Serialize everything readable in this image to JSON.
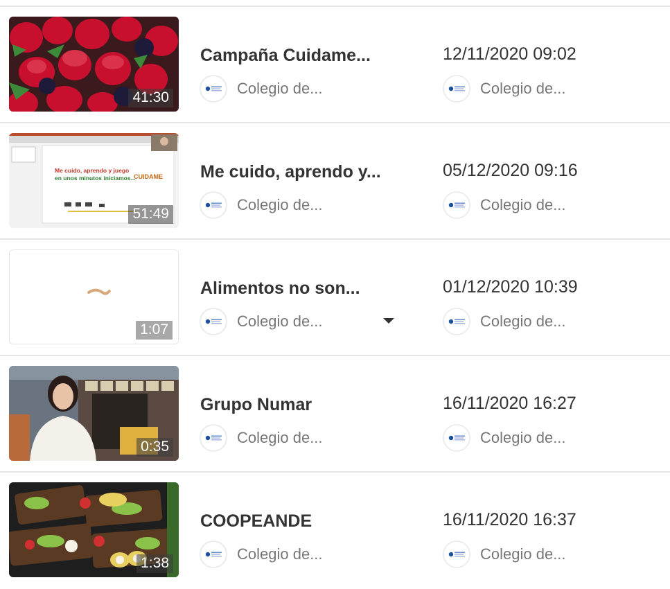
{
  "videos": [
    {
      "title": "Campaña Cuidame...",
      "duration": "41:30",
      "date": "12/11/2020 09:02",
      "channel": "Colegio de...",
      "author": "Colegio de..."
    },
    {
      "title": "Me cuido, aprendo y...",
      "duration": "51:49",
      "date": "05/12/2020 09:16",
      "channel": "Colegio de...",
      "author": "Colegio de...",
      "slide_heading": "Me cuido, aprendo y juego",
      "slide_subheading": "en unos minutos iniciamos...",
      "slide_logo": "CUIDAME"
    },
    {
      "title": "Alimentos no son...",
      "duration": "1:07",
      "date": "01/12/2020 10:39",
      "channel": "Colegio de...",
      "author": "Colegio de..."
    },
    {
      "title": "Grupo Numar",
      "duration": "0:35",
      "date": "16/11/2020 16:27",
      "channel": "Colegio de...",
      "author": "Colegio de..."
    },
    {
      "title": "COOPEANDE",
      "duration": "1:38",
      "date": "16/11/2020 16:37",
      "channel": "Colegio de...",
      "author": "Colegio de..."
    }
  ],
  "icons": {
    "logo": "college-logo-icon",
    "dropdown": "caret-down-icon"
  },
  "colors": {
    "divider": "#e4e4e4",
    "title": "#333333",
    "secondary": "#777777"
  }
}
